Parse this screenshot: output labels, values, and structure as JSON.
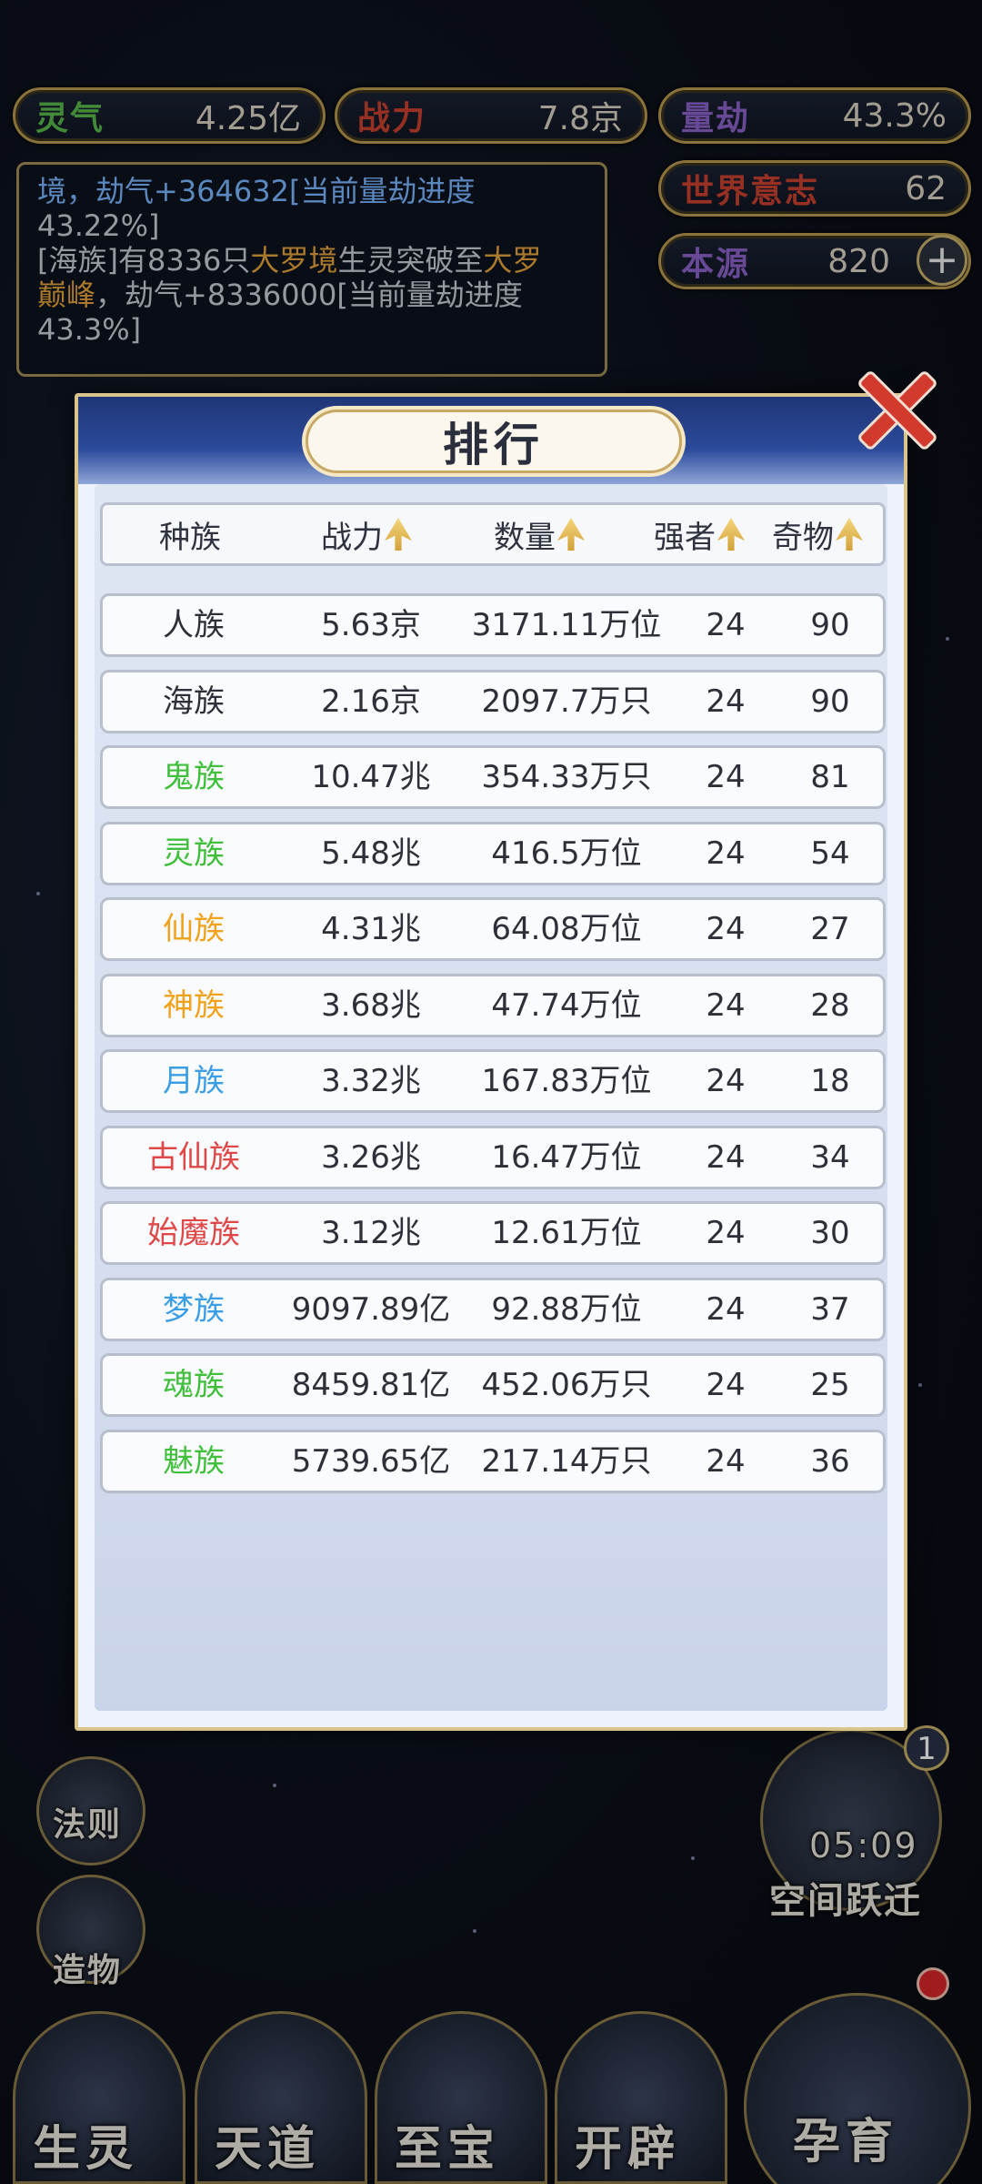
{
  "top_stats": [
    {
      "label": "灵气",
      "value": "4.25亿",
      "color": "#58b94a"
    },
    {
      "label": "战力",
      "value": "7.8京",
      "color": "#c9402e"
    },
    {
      "label": "量劫",
      "value": "43.3%",
      "color": "#8a62c9"
    }
  ],
  "world_will": {
    "label": "世界意志",
    "value": "62",
    "color": "#c9402e"
  },
  "origin": {
    "label": "本源",
    "value": "820",
    "color": "#8a62c9",
    "plus": "+"
  },
  "log": {
    "line1_a": "境，劫气+364632[当前量劫进度",
    "line1_b": "43.22%]",
    "line2_a": "[海族]有8336只",
    "line2_gold1": "大罗境",
    "line2_b": "生灵突破至",
    "line2_gold2": "大罗",
    "line3_gold": "巅峰",
    "line3_b": "，劫气+8336000[当前量劫进度",
    "line4": "43.3%]"
  },
  "side_right": {
    "timer": "05:09",
    "space_jump_label": "空间跃迁",
    "badge": "1"
  },
  "side_left": {
    "law_label": "法则",
    "creation_label": "造物"
  },
  "bottom_nav": [
    "生灵",
    "天道",
    "至宝",
    "开辟",
    "孕育"
  ],
  "modal": {
    "title": "排行",
    "columns": [
      "种族",
      "战力",
      "数量",
      "强者",
      "奇物"
    ],
    "rows": [
      {
        "race": "人族",
        "power": "5.63京",
        "count": "3171.11万位",
        "strong": "24",
        "items": "90",
        "color": "#2d3038"
      },
      {
        "race": "海族",
        "power": "2.16京",
        "count": "2097.7万只",
        "strong": "24",
        "items": "90",
        "color": "#2d3038"
      },
      {
        "race": "鬼族",
        "power": "10.47兆",
        "count": "354.33万只",
        "strong": "24",
        "items": "81",
        "color": "#3fbf3a"
      },
      {
        "race": "灵族",
        "power": "5.48兆",
        "count": "416.5万位",
        "strong": "24",
        "items": "54",
        "color": "#3fbf3a"
      },
      {
        "race": "仙族",
        "power": "4.31兆",
        "count": "64.08万位",
        "strong": "24",
        "items": "27",
        "color": "#f0a21a"
      },
      {
        "race": "神族",
        "power": "3.68兆",
        "count": "47.74万位",
        "strong": "24",
        "items": "28",
        "color": "#f0a21a"
      },
      {
        "race": "月族",
        "power": "3.32兆",
        "count": "167.83万位",
        "strong": "24",
        "items": "18",
        "color": "#3a9ee6"
      },
      {
        "race": "古仙族",
        "power": "3.26兆",
        "count": "16.47万位",
        "strong": "24",
        "items": "34",
        "color": "#e04848"
      },
      {
        "race": "始魔族",
        "power": "3.12兆",
        "count": "12.61万位",
        "strong": "24",
        "items": "30",
        "color": "#e04848"
      },
      {
        "race": "梦族",
        "power": "9097.89亿",
        "count": "92.88万位",
        "strong": "24",
        "items": "37",
        "color": "#3a9ee6"
      },
      {
        "race": "魂族",
        "power": "8459.81亿",
        "count": "452.06万只",
        "strong": "24",
        "items": "25",
        "color": "#3fbf3a"
      },
      {
        "race": "魅族",
        "power": "5739.65亿",
        "count": "217.14万只",
        "strong": "24",
        "items": "36",
        "color": "#3fbf3a"
      }
    ]
  }
}
